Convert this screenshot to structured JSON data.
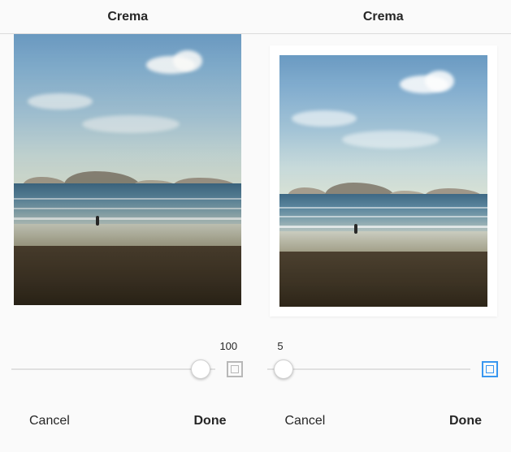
{
  "panels": [
    {
      "title": "Crema",
      "slider": {
        "value": 100,
        "pct": 93
      },
      "frame": false,
      "actions": {
        "cancel": "Cancel",
        "done": "Done"
      }
    },
    {
      "title": "Crema",
      "slider": {
        "value": 5,
        "pct": 8
      },
      "frame": true,
      "actions": {
        "cancel": "Cancel",
        "done": "Done"
      }
    }
  ]
}
